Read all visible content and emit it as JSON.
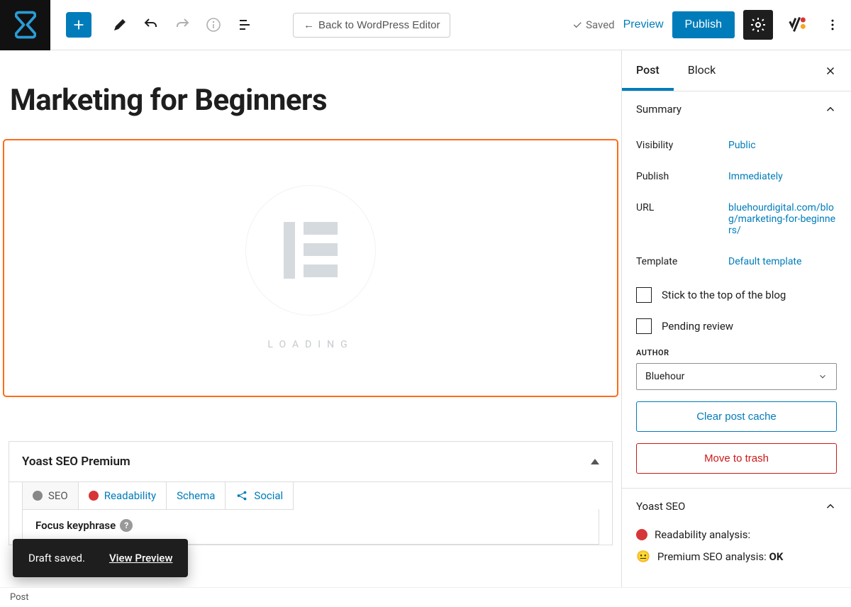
{
  "toolbar": {
    "back_label": "Back to WordPress Editor",
    "saved_label": "Saved",
    "preview_label": "Preview",
    "publish_label": "Publish"
  },
  "post": {
    "title": "Marketing for Beginners",
    "loading": "LOADING"
  },
  "yoast": {
    "title": "Yoast SEO Premium",
    "tabs": {
      "seo": "SEO",
      "readability": "Readability",
      "schema": "Schema",
      "social": "Social"
    },
    "focus_keyphrase_label": "Focus keyphrase"
  },
  "sidebar": {
    "tabs": {
      "post": "Post",
      "block": "Block"
    },
    "summary": {
      "title": "Summary",
      "visibility_label": "Visibility",
      "visibility_value": "Public",
      "publish_label": "Publish",
      "publish_value": "Immediately",
      "url_label": "URL",
      "url_value": "bluehourdigital.com/blog/marketing-for-beginners/",
      "template_label": "Template",
      "template_value": "Default template",
      "stick_label": "Stick to the top of the blog",
      "pending_label": "Pending review",
      "author_label": "AUTHOR",
      "author_value": "Bluehour",
      "clear_cache": "Clear post cache",
      "trash": "Move to trash"
    },
    "yoast_panel": {
      "title": "Yoast SEO",
      "readability": "Readability analysis:",
      "premium": "Premium SEO analysis: ",
      "premium_status": "OK"
    }
  },
  "toast": {
    "message": "Draft saved.",
    "action": "View Preview"
  },
  "status_bar": "Post",
  "colors": {
    "primary": "#007cba",
    "orange": "#ff6b1a",
    "danger": "#cc1818"
  }
}
